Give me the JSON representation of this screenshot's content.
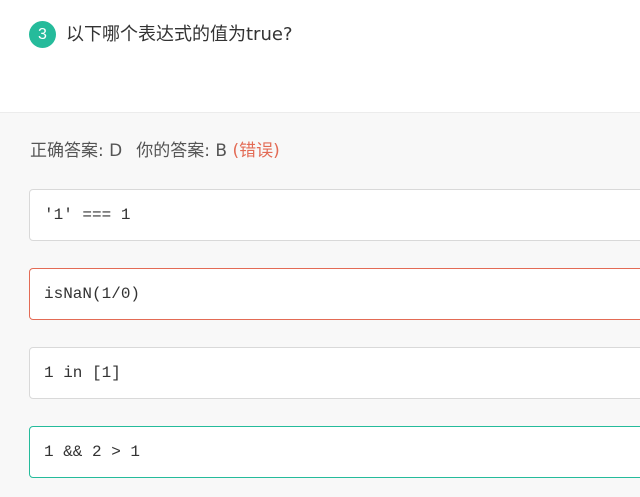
{
  "question": {
    "number": "3",
    "title": "以下哪个表达式的值为true?"
  },
  "result": {
    "correct_label": "正确答案: D",
    "yours_label": "你的答案: B",
    "status": "(错误)"
  },
  "options": [
    {
      "code": "'1' === 1",
      "state": "normal"
    },
    {
      "code": "isNaN(1/0)",
      "state": "wrong"
    },
    {
      "code": "1 in [1]",
      "state": "normal"
    },
    {
      "code": "1 && 2 > 1",
      "state": "correct"
    }
  ],
  "colors": {
    "accent": "#25bb9b",
    "error": "#e36b55"
  }
}
